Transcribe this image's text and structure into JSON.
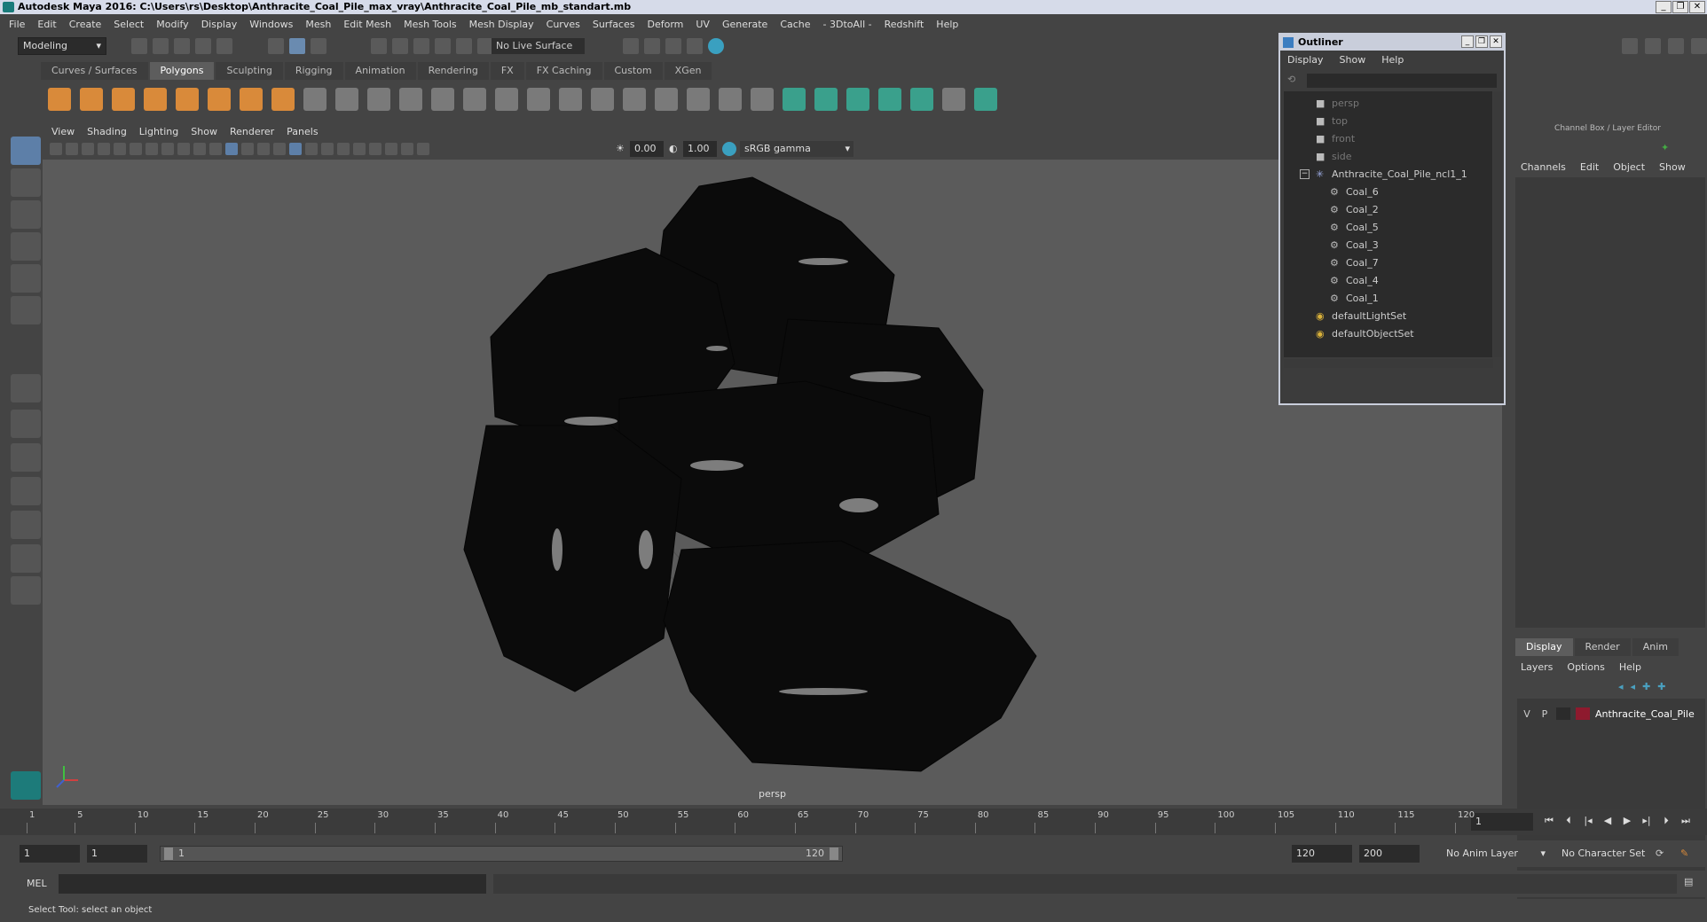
{
  "window": {
    "title": "Autodesk Maya 2016: C:\\Users\\rs\\Desktop\\Anthracite_Coal_Pile_max_vray\\Anthracite_Coal_Pile_mb_standart.mb",
    "minimize": "_",
    "maximize": "❐",
    "close": "✕"
  },
  "menubar": [
    "File",
    "Edit",
    "Create",
    "Select",
    "Modify",
    "Display",
    "Windows",
    "Mesh",
    "Edit Mesh",
    "Mesh Tools",
    "Mesh Display",
    "Curves",
    "Surfaces",
    "Deform",
    "UV",
    "Generate",
    "Cache",
    "- 3DtoAll -",
    "Redshift",
    "Help"
  ],
  "status": {
    "mode": "Modeling",
    "live_surface": "No Live Surface"
  },
  "shelf": {
    "tabs": [
      "Curves / Surfaces",
      "Polygons",
      "Sculpting",
      "Rigging",
      "Animation",
      "Rendering",
      "FX",
      "FX Caching",
      "Custom",
      "XGen"
    ],
    "active": "Polygons"
  },
  "panel": {
    "menu": [
      "View",
      "Shading",
      "Lighting",
      "Show",
      "Renderer",
      "Panels"
    ],
    "exposure": "0.00",
    "gamma": "1.00",
    "color_space": "sRGB gamma",
    "camera_label": "persp"
  },
  "outliner": {
    "title": "Outliner",
    "menu": [
      "Display",
      "Show",
      "Help"
    ],
    "items": [
      {
        "label": "persp",
        "icon": "camera-icon",
        "dim": true,
        "indent": 0
      },
      {
        "label": "top",
        "icon": "camera-icon",
        "dim": true,
        "indent": 0
      },
      {
        "label": "front",
        "icon": "camera-icon",
        "dim": true,
        "indent": 0
      },
      {
        "label": "side",
        "icon": "camera-icon",
        "dim": true,
        "indent": 0
      },
      {
        "label": "Anthracite_Coal_Pile_ncl1_1",
        "icon": "group-icon",
        "dim": false,
        "indent": 0
      },
      {
        "label": "Coal_6",
        "icon": "mesh-icon",
        "dim": false,
        "indent": 1
      },
      {
        "label": "Coal_2",
        "icon": "mesh-icon",
        "dim": false,
        "indent": 1
      },
      {
        "label": "Coal_5",
        "icon": "mesh-icon",
        "dim": false,
        "indent": 1
      },
      {
        "label": "Coal_3",
        "icon": "mesh-icon",
        "dim": false,
        "indent": 1
      },
      {
        "label": "Coal_7",
        "icon": "mesh-icon",
        "dim": false,
        "indent": 1
      },
      {
        "label": "Coal_4",
        "icon": "mesh-icon",
        "dim": false,
        "indent": 1
      },
      {
        "label": "Coal_1",
        "icon": "mesh-icon",
        "dim": false,
        "indent": 1
      },
      {
        "label": "defaultLightSet",
        "icon": "set-icon",
        "dim": false,
        "indent": 0
      },
      {
        "label": "defaultObjectSet",
        "icon": "set-icon",
        "dim": false,
        "indent": 0
      }
    ]
  },
  "channel_box": {
    "title": "Channel Box / Layer Editor",
    "menu": [
      "Channels",
      "Edit",
      "Object",
      "Show"
    ],
    "layer_tabs": [
      "Display",
      "Render",
      "Anim"
    ],
    "layer_menu": [
      "Layers",
      "Options",
      "Help"
    ],
    "layer": {
      "v": "V",
      "p": "P",
      "name": "Anthracite_Coal_Pile",
      "color": "#8e1a2e"
    }
  },
  "timeline": {
    "ticks": [
      1,
      5,
      10,
      15,
      20,
      25,
      30,
      35,
      40,
      45,
      50,
      55,
      60,
      65,
      70,
      75,
      80,
      85,
      90,
      95,
      100,
      105,
      110,
      115,
      120
    ],
    "current_frame": "1"
  },
  "range": {
    "start": "1",
    "start2": "1",
    "slider_start": "1",
    "slider_end": "120",
    "end": "120",
    "end2": "200",
    "anim_layer": "No Anim Layer",
    "character_set": "No Character Set"
  },
  "cmdline": {
    "label": "MEL"
  },
  "helpline": {
    "text": "Select Tool: select an object"
  }
}
